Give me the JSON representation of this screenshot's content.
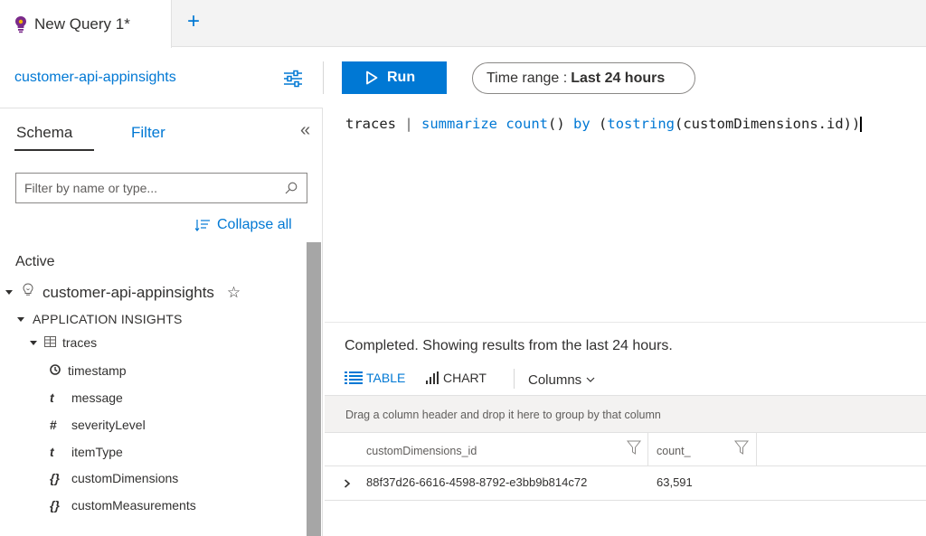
{
  "tabs": [
    {
      "label": "New Query 1*"
    }
  ],
  "tab_add_label": "+",
  "resource": {
    "name": "customer-api-appinsights"
  },
  "toolbar": {
    "run_label": "Run",
    "time_range_prefix": "Time range :",
    "time_range_value": "Last 24 hours"
  },
  "left_panel": {
    "tab_schema": "Schema",
    "tab_filter": "Filter",
    "collapse_glyph": "«",
    "filter_placeholder": "Filter by name or type...",
    "collapse_all": "Collapse all",
    "active_label": "Active",
    "tree": {
      "resource": "customer-api-appinsights",
      "group": "APPLICATION INSIGHTS",
      "table": "traces",
      "fields": [
        {
          "icon": "clock-icon",
          "name": "timestamp"
        },
        {
          "icon": "t",
          "name": "message"
        },
        {
          "icon": "#",
          "name": "severityLevel"
        },
        {
          "icon": "t",
          "name": "itemType"
        },
        {
          "icon": "{}",
          "name": "customDimensions"
        },
        {
          "icon": "{}",
          "name": "customMeasurements"
        }
      ]
    }
  },
  "editor": {
    "tokens": [
      {
        "text": "traces",
        "kind": "plain"
      },
      {
        "text": " | ",
        "kind": "pipe"
      },
      {
        "text": "summarize",
        "kind": "kw"
      },
      {
        "text": " ",
        "kind": "plain"
      },
      {
        "text": "count",
        "kind": "kw"
      },
      {
        "text": "() ",
        "kind": "plain"
      },
      {
        "text": "by",
        "kind": "kw"
      },
      {
        "text": " (",
        "kind": "plain"
      },
      {
        "text": "tostring",
        "kind": "kw"
      },
      {
        "text": "(customDimensions.id))",
        "kind": "plain"
      }
    ]
  },
  "results": {
    "status": "Completed. Showing results from the last 24 hours.",
    "view_table": "TABLE",
    "view_chart": "CHART",
    "columns_label": "Columns",
    "group_hint": "Drag a column header and drop it here to group by that column",
    "columns": [
      "customDimensions_id",
      "count_"
    ],
    "rows": [
      {
        "id": "88f37d26-6616-4598-8792-e3bb9b814c72",
        "count": "63,591"
      }
    ]
  },
  "colors": {
    "accent": "#0078d4",
    "scrollbar": "#a6a6a6",
    "tab_bar": "#f3f3f3"
  }
}
